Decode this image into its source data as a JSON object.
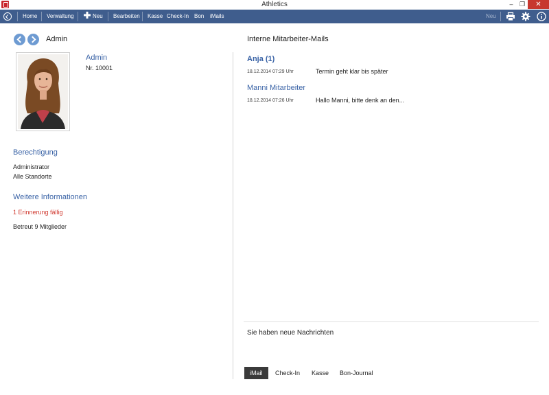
{
  "window": {
    "title": "Athletics",
    "minimize_glyph": "–",
    "restore_glyph": "❐",
    "close_glyph": "✕"
  },
  "toolbar": {
    "home": "Home",
    "verwaltung": "Verwaltung",
    "neu": "Neu",
    "bearbeiten": "Bearbeiten",
    "kasse": "Kasse",
    "checkin": "Check-In",
    "bon": "Bon",
    "imails": "iMails",
    "neu_right": "Neu",
    "icons": [
      "back-icon",
      "plus-icon",
      "print-icon",
      "gear-icon",
      "info-icon"
    ]
  },
  "profile": {
    "breadcrumb": "Admin",
    "name": "Admin",
    "number": "Nr. 10001"
  },
  "berechtigung": {
    "heading": "Berechtigung",
    "lines": [
      "Administrator",
      "Alle Standorte"
    ]
  },
  "weitere": {
    "heading": "Weitere Informationen",
    "reminder": "1 Erinnerung fällig",
    "members": "Betreut 9 Mitglieder"
  },
  "mails": {
    "title": "Interne Mitarbeiter-Mails",
    "items": [
      {
        "sender": "Anja  (1)",
        "date": "18.12.2014 07:29 Uhr",
        "subject": "Termin geht klar bis später"
      },
      {
        "sender": "Manni Mitarbeiter",
        "date": "18.12.2014 07:26 Uhr",
        "subject": "Hallo Manni, bitte denk an den..."
      }
    ]
  },
  "notice": "Sie haben neue Nachrichten",
  "tabs": [
    "iMail",
    "Check-In",
    "Kasse",
    "Bon-Journal"
  ],
  "colors": {
    "toolbar_bg": "#3f5d8d",
    "accent": "#3a63a6",
    "reminder": "#d0392f",
    "close_button": "#c7372f"
  }
}
